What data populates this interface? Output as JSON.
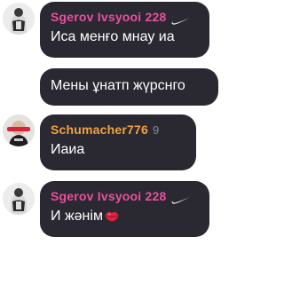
{
  "messages": [
    {
      "username": "Sgerov Ivsyooi 228",
      "username_color": "#ea4fa2",
      "badge_icon": "swoosh-icon",
      "text": "Иса менғо мнау иа"
    },
    {
      "text": "Мены ұнатп жүрснго"
    },
    {
      "username": "Schumacher776",
      "username_color": "#f4a13f",
      "suffix": "9",
      "text": "Иаиа"
    },
    {
      "username": "Sgerov Ivsyooi 228",
      "username_color": "#ea4fa2",
      "badge_icon": "swoosh-icon",
      "text": "И жәнім",
      "emoji": "lips-icon"
    }
  ],
  "colors": {
    "bubble_bg": "#2a2830",
    "message_text": "#ffffff",
    "page_bg": "#ffffff"
  }
}
